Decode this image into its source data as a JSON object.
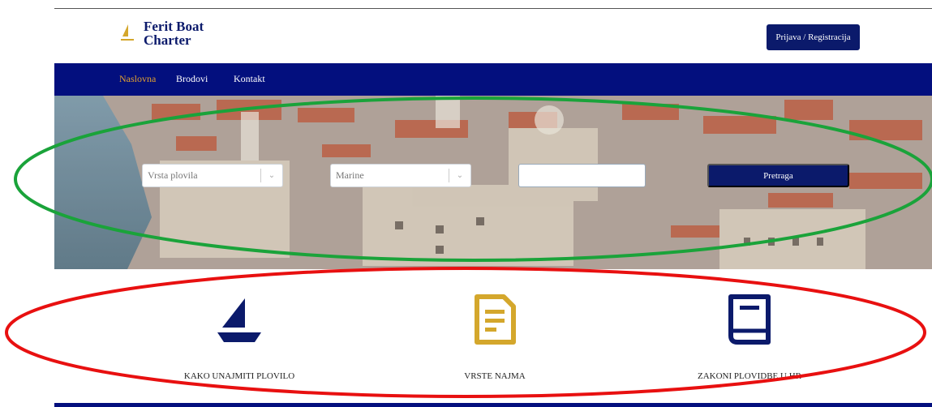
{
  "brand": {
    "name_line1": "Ferit Boat",
    "name_line2": "Charter"
  },
  "header": {
    "login_label": "Prijava / Registracija"
  },
  "nav": {
    "items": [
      {
        "label": "Naslovna",
        "active": true
      },
      {
        "label": "Brodovi",
        "active": false
      },
      {
        "label": "Kontakt",
        "active": false
      }
    ]
  },
  "search": {
    "vessel_type_placeholder": "Vrsta plovila",
    "marina_placeholder": "Marine",
    "text_value": "",
    "button_label": "Pretraga"
  },
  "features": [
    {
      "label": "KAKO UNAJMITI PLOVILO",
      "icon": "sailboat-icon",
      "color": "#0b1a6b"
    },
    {
      "label": "VRSTE NAJMA",
      "icon": "document-icon",
      "color": "#d4a72c"
    },
    {
      "label": "ZAKONI PLOVIDBE U HR",
      "icon": "book-icon",
      "color": "#0b1a6b"
    }
  ],
  "colors": {
    "brand_navy": "#0b1a6b",
    "nav_blue": "#030f7e",
    "active_nav": "#e0a030",
    "gold": "#d4a72c",
    "annotation_green": "#1aa33a",
    "annotation_red": "#e81010"
  }
}
